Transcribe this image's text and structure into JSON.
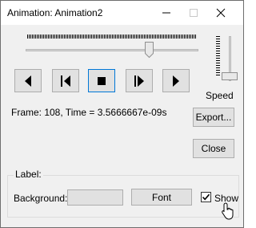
{
  "window": {
    "title": "Animation: Animation2"
  },
  "titlebar": {
    "minimize": "minimize",
    "maximize": "maximize",
    "close": "close"
  },
  "frame_info": "Frame: 108, Time = 3.5666667e-09s",
  "speed_label": "Speed",
  "buttons": {
    "export": "Export...",
    "close": "Close",
    "font": "Font"
  },
  "media_controls": [
    {
      "name": "step-back",
      "icon": "triangle-left-icon"
    },
    {
      "name": "rewind",
      "icon": "bar-triangle-left-icon"
    },
    {
      "name": "stop",
      "icon": "square-stop-icon"
    },
    {
      "name": "play-step",
      "icon": "bar-triangle-right-icon"
    },
    {
      "name": "play",
      "icon": "triangle-right-icon"
    }
  ],
  "label_group": {
    "title": "Label:",
    "background_label": "Background:",
    "show_label": "Show",
    "show_checked": true
  },
  "sliders": {
    "frame_position": 0.7,
    "speed_position": 0.9
  }
}
